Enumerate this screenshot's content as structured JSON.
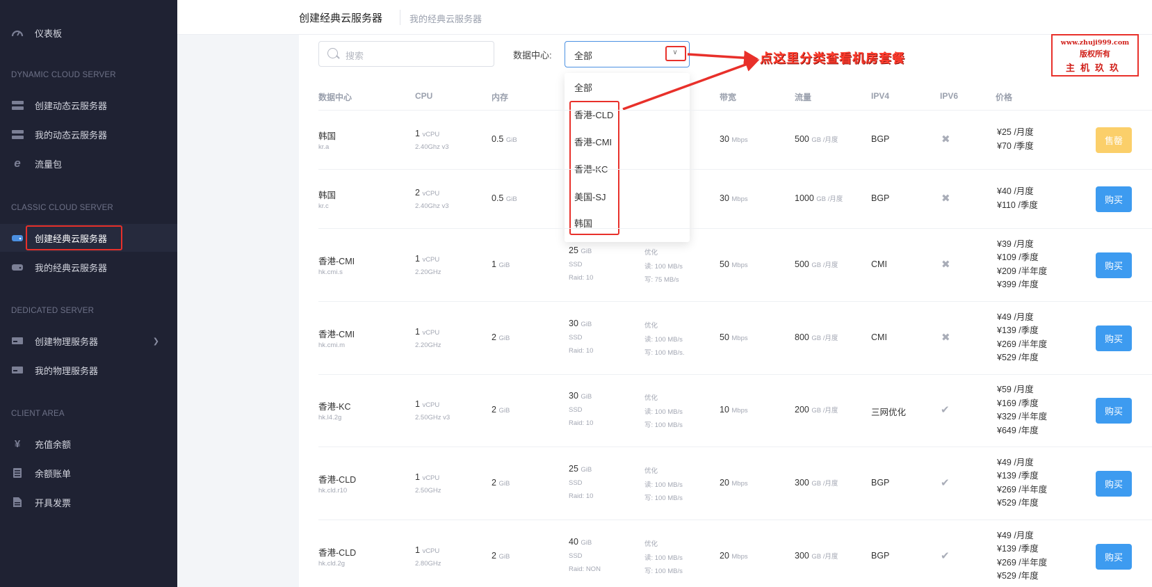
{
  "sidebar": {
    "dashboard": "仪表板",
    "sections": [
      {
        "title": "DYNAMIC CLOUD SERVER",
        "items": [
          "创建动态云服务器",
          "我的动态云服务器",
          "流量包"
        ]
      },
      {
        "title": "CLASSIC CLOUD SERVER",
        "items": [
          "创建经典云服务器",
          "我的经典云服务器"
        ]
      },
      {
        "title": "DEDICATED SERVER",
        "items": [
          "创建物理服务器",
          "我的物理服务器"
        ]
      },
      {
        "title": "CLIENT AREA",
        "items": [
          "充值余额",
          "余额账单",
          "开具发票"
        ]
      }
    ],
    "active_item": "创建经典云服务器"
  },
  "header": {
    "tab_active": "创建经典云服务器",
    "tab_other": "我的经典云服务器"
  },
  "filters": {
    "search_placeholder": "搜索",
    "dc_label": "数据中心:",
    "dc_selected": "全部",
    "dc_options": [
      "全部",
      "香港-CLD",
      "香港-CMI",
      "香港-KC",
      "美国-SJ",
      "韩国"
    ]
  },
  "watermark": {
    "line1": "www.zhuji999.com",
    "line2": "版权所有",
    "line3": "主机玖玖"
  },
  "annotation": "点这里分类查看机房套餐",
  "table": {
    "headers": [
      "数据中心",
      "CPU",
      "内存",
      "带宽",
      "流量",
      "IPV4",
      "IPV6",
      "价格"
    ],
    "rows": [
      {
        "dc": "韩国",
        "code": "kr.a",
        "cpu": "1",
        "cpu_unit": "vCPU",
        "cpu_freq": "2.40Ghz v3",
        "mem": "0.5",
        "mem_unit": "GiB",
        "disk": "",
        "disk_unit": "",
        "disk_type": "",
        "raid": "",
        "io": "",
        "io_read": "",
        "io_write": "",
        "bw": "30",
        "bw_unit": "Mbps",
        "traffic": "500",
        "traffic_unit": "GB /月度",
        "ipv4": "BGP",
        "ipv6": "no",
        "prices": [
          "¥25 /月度",
          "¥70 /季度"
        ],
        "action": "售罄"
      },
      {
        "dc": "韩国",
        "code": "kr.c",
        "cpu": "2",
        "cpu_unit": "vCPU",
        "cpu_freq": "2.40Ghz v3",
        "mem": "0.5",
        "mem_unit": "GiB",
        "disk": "",
        "disk_unit": "",
        "disk_type": "",
        "raid": "",
        "io": "",
        "io_read": "",
        "io_write": "",
        "bw": "30",
        "bw_unit": "Mbps",
        "traffic": "1000",
        "traffic_unit": "GB /月度",
        "ipv4": "BGP",
        "ipv6": "no",
        "prices": [
          "¥40 /月度",
          "¥110 /季度"
        ],
        "action": "购买"
      },
      {
        "dc": "香港-CMI",
        "code": "hk.cmi.s",
        "cpu": "1",
        "cpu_unit": "vCPU",
        "cpu_freq": "2.20GHz",
        "mem": "1",
        "mem_unit": "GiB",
        "disk": "25",
        "disk_unit": "GiB",
        "disk_type": "SSD",
        "raid": "Raid:  10",
        "io": "优化",
        "io_read": "读:  100 MB/s",
        "io_write": "写:  75 MB/s",
        "bw": "50",
        "bw_unit": "Mbps",
        "traffic": "500",
        "traffic_unit": "GB /月度",
        "ipv4": "CMI",
        "ipv6": "no",
        "prices": [
          "¥39 /月度",
          "¥109 /季度",
          "¥209 /半年度",
          "¥399 /年度"
        ],
        "action": "购买"
      },
      {
        "dc": "香港-CMI",
        "code": "hk.cmi.m",
        "cpu": "1",
        "cpu_unit": "vCPU",
        "cpu_freq": "2.20GHz",
        "mem": "2",
        "mem_unit": "GiB",
        "disk": "30",
        "disk_unit": "GiB",
        "disk_type": "SSD",
        "raid": "Raid:  10",
        "io": "优化",
        "io_read": "读:  100 MB/s",
        "io_write": "写:  100 MB/s.",
        "bw": "50",
        "bw_unit": "Mbps",
        "traffic": "800",
        "traffic_unit": "GB /月度",
        "ipv4": "CMI",
        "ipv6": "no",
        "prices": [
          "¥49 /月度",
          "¥139 /季度",
          "¥269 /半年度",
          "¥529 /年度"
        ],
        "action": "购买"
      },
      {
        "dc": "香港-KC",
        "code": "hk.l4.2g",
        "cpu": "1",
        "cpu_unit": "vCPU",
        "cpu_freq": "2.50GHz v3",
        "mem": "2",
        "mem_unit": "GiB",
        "disk": "30",
        "disk_unit": "GiB",
        "disk_type": "SSD",
        "raid": "Raid:  10",
        "io": "优化",
        "io_read": "读:  100 MB/s",
        "io_write": "写:  100 MB/s",
        "bw": "10",
        "bw_unit": "Mbps",
        "traffic": "200",
        "traffic_unit": "GB /月度",
        "ipv4": "三网优化",
        "ipv6": "yes",
        "prices": [
          "¥59 /月度",
          "¥169 /季度",
          "¥329 /半年度",
          "¥649 /年度"
        ],
        "action": "购买"
      },
      {
        "dc": "香港-CLD",
        "code": "hk.cld.r10",
        "cpu": "1",
        "cpu_unit": "vCPU",
        "cpu_freq": "2.50GHz",
        "mem": "2",
        "mem_unit": "GiB",
        "disk": "25",
        "disk_unit": "GiB",
        "disk_type": "SSD",
        "raid": "Raid:  10",
        "io": "优化",
        "io_read": "读:  100 MB/s",
        "io_write": "写:  100 MB/s",
        "bw": "20",
        "bw_unit": "Mbps",
        "traffic": "300",
        "traffic_unit": "GB /月度",
        "ipv4": "BGP",
        "ipv6": "yes",
        "prices": [
          "¥49 /月度",
          "¥139 /季度",
          "¥269 /半年度",
          "¥529 /年度"
        ],
        "action": "购买"
      },
      {
        "dc": "香港-CLD",
        "code": "hk.cld.2g",
        "cpu": "1",
        "cpu_unit": "vCPU",
        "cpu_freq": "2.80GHz",
        "mem": "2",
        "mem_unit": "GiB",
        "disk": "40",
        "disk_unit": "GiB",
        "disk_type": "SSD",
        "raid": "Raid:  NON",
        "io": "优化",
        "io_read": "读:  100 MB/s",
        "io_write": "写:  100 MB/s",
        "bw": "20",
        "bw_unit": "Mbps",
        "traffic": "300",
        "traffic_unit": "GB /月度",
        "ipv4": "BGP",
        "ipv6": "yes",
        "prices": [
          "¥49 /月度",
          "¥139 /季度",
          "¥269 /半年度",
          "¥529 /年度"
        ],
        "action": "购买"
      }
    ]
  },
  "colors": {
    "sidebar_bg": "#1f2233",
    "accent": "#3d9bf0",
    "sold_out": "#fbcf6a",
    "annotation_red": "#e8302a"
  }
}
